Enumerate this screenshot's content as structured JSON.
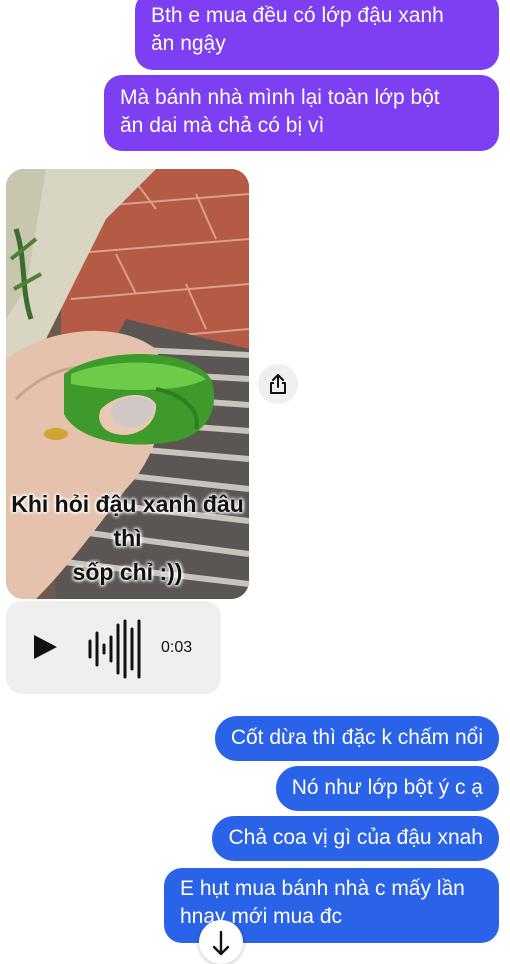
{
  "messages": {
    "m1": "Bth e mua đều có lớp đậu xanh\năn ngậy",
    "m2": "Mà bánh nhà mình lại toàn lớp bột\năn dai mà chả có bị vì",
    "photo_caption": "Khi hỏi đậu xanh đâu thì\nsốp chỉ :))",
    "audio_duration": "0:03",
    "m3": "Cốt dừa thì đặc k chấm nổi",
    "m4": "Nó như lớp bột ý c ạ",
    "m5": "Chả coa vị gì của đậu xnah",
    "m6": "E hụt mua bánh nhà c mấy lần\nhnay mới mua đc"
  },
  "icons": {
    "share": "share-icon",
    "play": "play-icon",
    "waveform": "waveform-icon",
    "scroll_down": "arrow-down-icon"
  },
  "colors": {
    "purple_bubble": "#7e3ff2",
    "blue_bubble": "#2a63e8",
    "audio_bg": "#efefef"
  }
}
